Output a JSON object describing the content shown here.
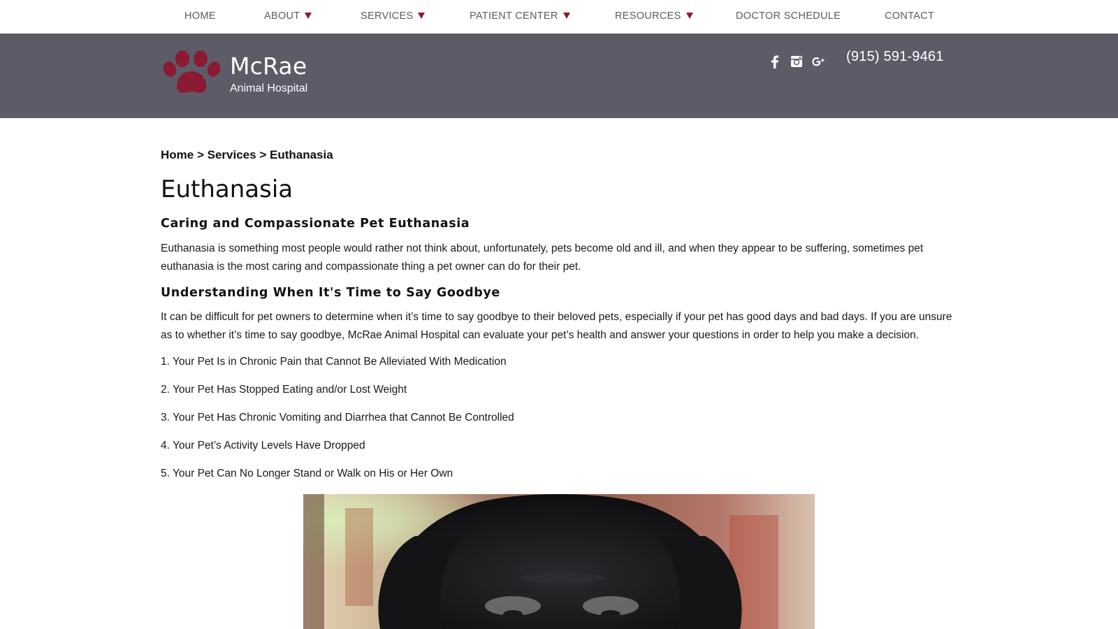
{
  "nav": {
    "items": [
      {
        "label": "HOME",
        "has_dropdown": false
      },
      {
        "label": "ABOUT",
        "has_dropdown": true
      },
      {
        "label": "SERVICES",
        "has_dropdown": true
      },
      {
        "label": "PATIENT CENTER",
        "has_dropdown": true
      },
      {
        "label": "RESOURCES",
        "has_dropdown": true
      },
      {
        "label": "DOCTOR SCHEDULE",
        "has_dropdown": false
      },
      {
        "label": "CONTACT",
        "has_dropdown": false
      }
    ]
  },
  "header": {
    "brand_name": "McRae",
    "brand_sub": "Animal Hospital",
    "logo_icon": "paw-print-icon",
    "social_icons": [
      "facebook-icon",
      "instagram-icon",
      "google-plus-icon"
    ],
    "phone": "(915) 591-9461"
  },
  "breadcrumb": {
    "home": "Home",
    "sep1": ">",
    "services": "Services",
    "sep2": ">",
    "current": "Euthanasia"
  },
  "main": {
    "title": "Euthanasia",
    "heading1": "Caring and Compassionate Pet Euthanasia",
    "para1": "Euthanasia is something most people would rather not think about, unfortunately, pets become old and ill, and when they appear to be suffering, sometimes pet euthanasia is the most caring and compassionate thing a pet owner can do for their pet.",
    "heading2": "Understanding When It's Time to Say Goodbye",
    "para2": "It can be difficult for pet owners to determine when it’s time to say goodbye to their beloved pets, especially if your pet has good days and bad days. If you are unsure as to whether it’s time to say goodbye, McRae Animal Hospital can evaluate your pet’s health and answer your questions in order to help you make a decision.",
    "list": [
      "1. Your Pet Is in Chronic Pain that Cannot Be Alleviated With Medication",
      "2. Your Pet Has Stopped Eating and/or Lost Weight",
      "3. Your Pet Has Chronic Vomiting and Diarrhea that Cannot Be Controlled",
      "4. Your Pet’s Activity Levels Have Dropped",
      "5. Your Pet Can No Longer Stand or Walk on His or Her Own"
    ]
  },
  "colors": {
    "header_bg": "#5c5c68",
    "accent": "#8c1a32",
    "nav_text": "#5b5b63"
  }
}
